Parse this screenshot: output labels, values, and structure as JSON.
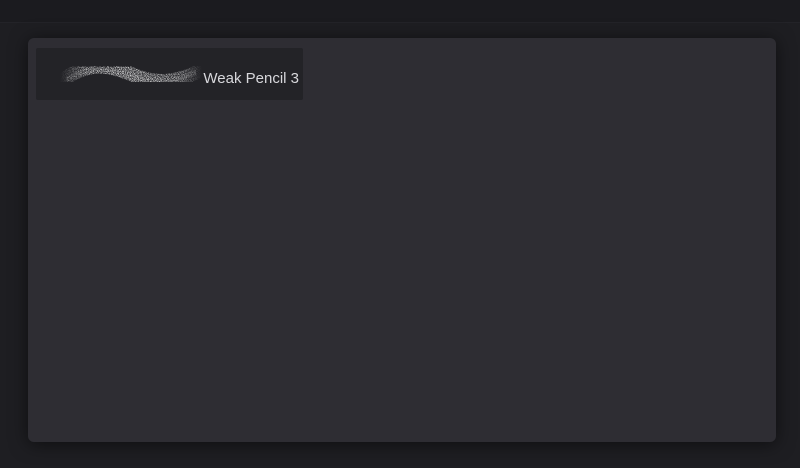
{
  "brush_library": {
    "brushes": [
      {
        "name": "Weak Pencil 3",
        "preview_icon": "pencil-stroke-preview-icon"
      }
    ]
  },
  "colors": {
    "background": "#1e1e22",
    "panel": "#2e2d33",
    "item": "#232327",
    "label": "#d8d8dc"
  }
}
